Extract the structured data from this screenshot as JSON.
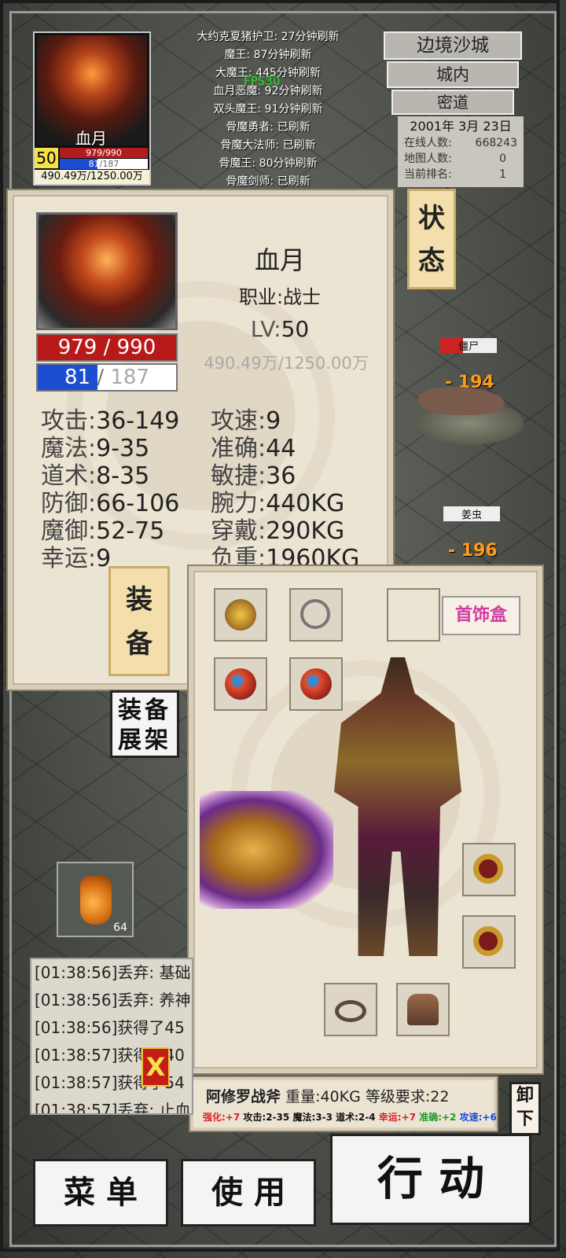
{
  "player": {
    "name": "血月",
    "level": "50",
    "hp_current": "979",
    "hp_max": "990",
    "hp_text_small": "979/990",
    "mp_current": "81",
    "mp_max": "187",
    "mp_fraction": 0.433,
    "exp_text_small": "490.49万/1250.00万",
    "exp_text": "490.49万/1250.00万"
  },
  "boss_refresh": [
    "大约克夏猪护卫: 27分钟刷新",
    "魔王: 87分钟刷新",
    "大魔王: 445分钟刷新",
    "血月恶魔: 92分钟刷新",
    "双头魔王: 91分钟刷新",
    "骨魔勇者: 已刷新",
    "骨魔大法师: 已刷新",
    "骨魔王: 80分钟刷新",
    "骨魔剑师: 已刷新"
  ],
  "fps": "FPS30",
  "location": {
    "map": "边境沙城",
    "area": "城内",
    "sub": "密道"
  },
  "server_info": {
    "date": "2001年 3月 23日",
    "online_label": "在线人数:",
    "online_value": "668243",
    "map_players_label": "地图人数:",
    "map_players_value": "0",
    "rank_label": "当前排名:",
    "rank_value": "1"
  },
  "status_panel": {
    "name": "血月",
    "job": "职业:战士",
    "lv_label": "LV:",
    "lv_value": "50",
    "hp_current": "979",
    "hp_max": "990",
    "mp_current": "81",
    "mp_max": "187",
    "exp": "490.49万/1250.00万",
    "stats_left": [
      {
        "label": "攻击:",
        "value": "36-149"
      },
      {
        "label": "魔法:",
        "value": "9-35"
      },
      {
        "label": "道术:",
        "value": "8-35"
      },
      {
        "label": "防御:",
        "value": "66-106"
      },
      {
        "label": "魔御:",
        "value": "52-75"
      },
      {
        "label": "幸运:",
        "value": "9"
      }
    ],
    "stats_right": [
      {
        "label": "攻速:",
        "value": "9"
      },
      {
        "label": "准确:",
        "value": "44"
      },
      {
        "label": "敏捷:",
        "value": "36"
      },
      {
        "label": "腕力:",
        "value": "440KG"
      },
      {
        "label": "穿戴:",
        "value": "290KG"
      },
      {
        "label": "负重:",
        "value": "1960KG"
      }
    ],
    "tab_label_1": "状",
    "tab_label_2": "态"
  },
  "equip_tab": {
    "label_1": "装",
    "label_2": "备"
  },
  "shelf_button": {
    "line1": "装备",
    "line2": "展架"
  },
  "monsters": [
    {
      "name": "僵尸",
      "damage": "- 194"
    },
    {
      "name": "姜虫",
      "damage": "- 196"
    }
  ],
  "equipment": {
    "jewel_box_label": "首饰盒",
    "slots": [
      {
        "name": "helmet",
        "icon": "helmet-icon",
        "color": "#b8892a"
      },
      {
        "name": "necklace",
        "icon": "necklace-icon",
        "color": "#8a8a8a"
      },
      {
        "name": "empty",
        "icon": "",
        "color": ""
      },
      {
        "name": "bracelet-left",
        "icon": "bracelet-icon",
        "color": "#c6452a"
      },
      {
        "name": "bracelet-right",
        "icon": "bracelet-icon",
        "color": "#c6452a"
      },
      {
        "name": "ring-top",
        "icon": "ring-icon",
        "color": "#c89a2a"
      },
      {
        "name": "ring-bottom",
        "icon": "ring-icon",
        "color": "#c89a2a"
      },
      {
        "name": "belt",
        "icon": "belt-icon",
        "color": "#8a6a3a"
      },
      {
        "name": "boots",
        "icon": "boots-icon",
        "color": "#7a4a2a"
      }
    ]
  },
  "selected_item": {
    "name": "阿修罗战斧",
    "weight": "重量:40KG",
    "level_req": "等级要求:22",
    "stats": [
      {
        "text": "强化:+7",
        "color": "#e0202a"
      },
      {
        "text": "攻击:2-35",
        "color": "#111111"
      },
      {
        "text": "魔法:3-3",
        "color": "#111111"
      },
      {
        "text": "道术:2-4",
        "color": "#111111"
      },
      {
        "text": "幸运:+7",
        "color": "#e0202a"
      },
      {
        "text": "准确:+2",
        "color": "#1a9a2a"
      },
      {
        "text": "攻速:+6",
        "color": "#1a4ad2"
      }
    ],
    "unequip_label_1": "卸",
    "unequip_label_2": "下"
  },
  "potion": {
    "count": "64"
  },
  "log": [
    "[01:38:56]丢弃: 基础",
    "[01:38:56]丢弃: 养神",
    "[01:38:56]获得了45",
    "[01:38:57]获得了40",
    "[01:38:57]获得了54",
    "[01:38:57]丢弃: 止血"
  ],
  "close_label": "X",
  "bottom": {
    "menu": "菜 单",
    "use": "使 用",
    "action": "行 动"
  }
}
